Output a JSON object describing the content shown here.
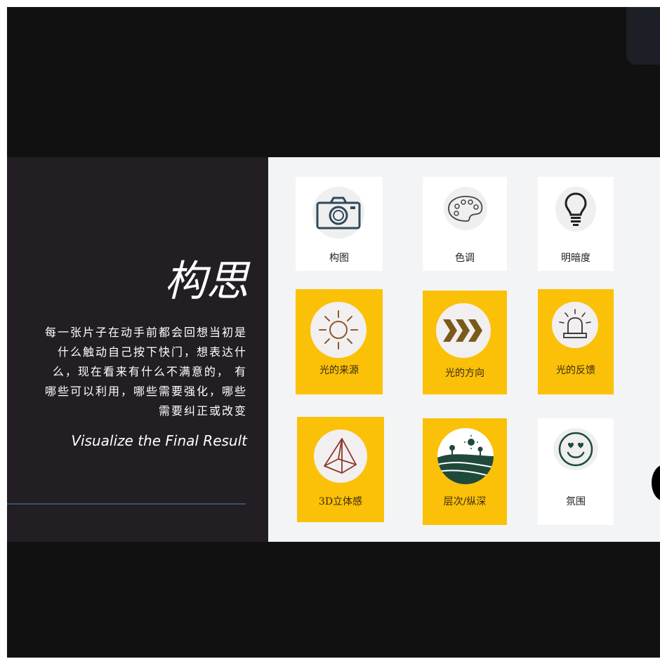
{
  "slide": {
    "title": "构思",
    "description": "每一张片子在动手前都会回想当初是什么触动自己按下快门，想表达什么，现在看来有什么不满意的， 有哪些可以利用，哪些需要强化，哪些需要纠正或改变",
    "subtitle": "Visualize the Final Result"
  },
  "cards": [
    {
      "label": "构图",
      "icon": "camera-icon",
      "style": "white"
    },
    {
      "label": "色调",
      "icon": "palette-icon",
      "style": "white"
    },
    {
      "label": "明暗度",
      "icon": "lightbulb-icon",
      "style": "white"
    },
    {
      "label": "光的来源",
      "icon": "sun-icon",
      "style": "yellow"
    },
    {
      "label": "光的方向",
      "icon": "chevrons-icon",
      "style": "yellow"
    },
    {
      "label": "光的反馈",
      "icon": "siren-icon",
      "style": "yellow"
    },
    {
      "label": "3D立体感",
      "icon": "pyramid-icon",
      "style": "yellow"
    },
    {
      "label": "层次/纵深",
      "icon": "landscape-icon",
      "style": "yellow"
    },
    {
      "label": "氛围",
      "icon": "smiley-icon",
      "style": "white"
    }
  ],
  "colors": {
    "accent_yellow": "#fbc108",
    "left_panel": "#221e24",
    "right_panel": "#f3f4f6",
    "background": "#111111"
  }
}
